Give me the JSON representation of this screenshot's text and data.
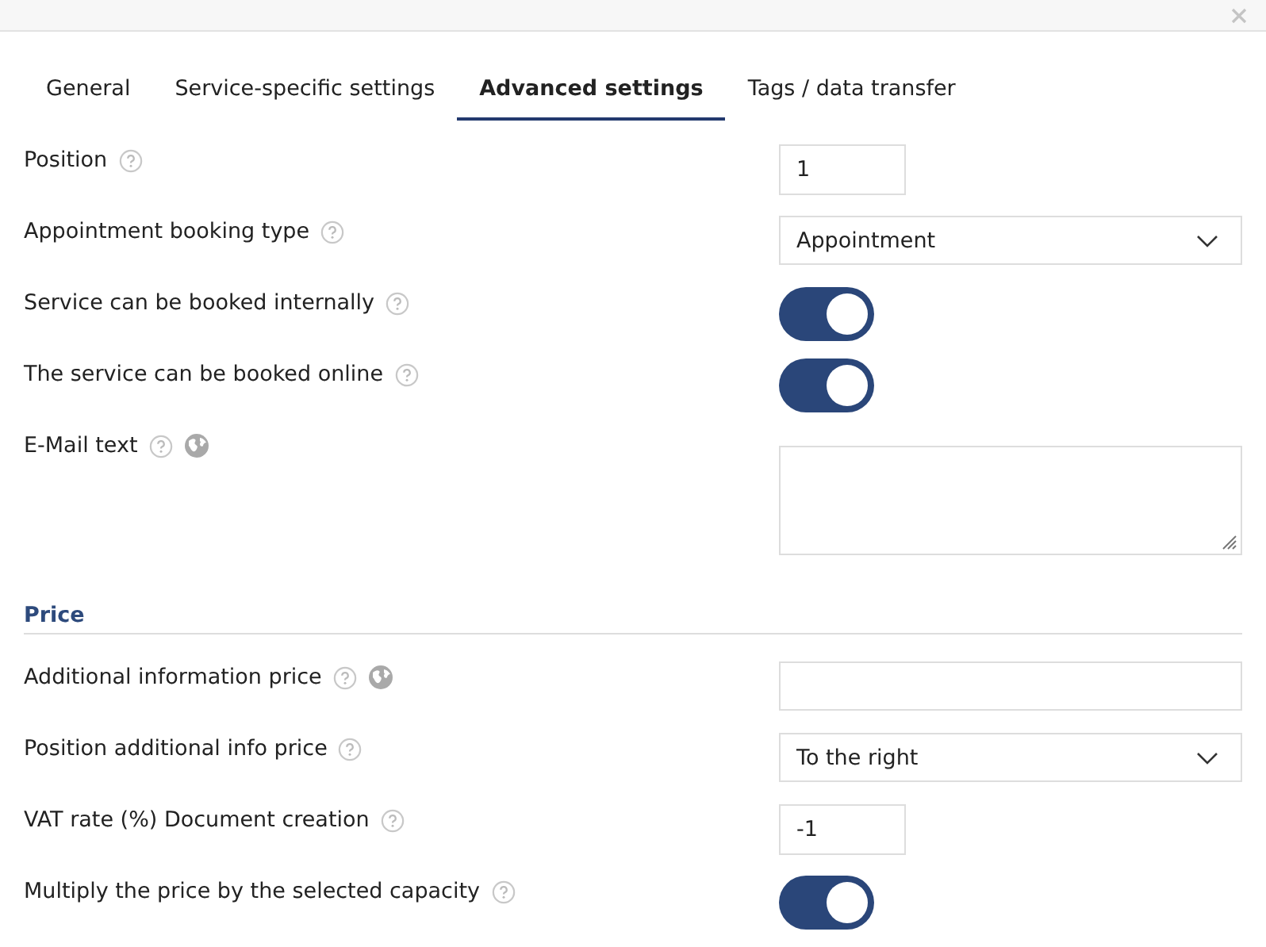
{
  "tabs": [
    {
      "label": "General",
      "selected": false
    },
    {
      "label": "Service-specific settings",
      "selected": false
    },
    {
      "label": "Advanced settings",
      "selected": true
    },
    {
      "label": "Tags / data transfer",
      "selected": false
    }
  ],
  "fields": [
    {
      "label": "Position",
      "help": true,
      "globe": false,
      "kind": "number",
      "value": "1"
    },
    {
      "label": "Appointment booking type",
      "help": true,
      "globe": false,
      "kind": "select",
      "value": "Appointment"
    },
    {
      "label": "Service can be booked internally",
      "help": true,
      "globe": false,
      "kind": "toggle",
      "on": true
    },
    {
      "label": "The service can be booked online",
      "help": true,
      "globe": false,
      "kind": "toggle",
      "on": true
    },
    {
      "label": "E-Mail text",
      "help": true,
      "globe": true,
      "kind": "textarea"
    }
  ],
  "price_section": {
    "title": "Price",
    "fields": [
      {
        "label": "Additional information price",
        "help": true,
        "globe": true,
        "kind": "text"
      },
      {
        "label": "Position additional info price",
        "help": true,
        "globe": false,
        "kind": "select",
        "value": "To the right"
      },
      {
        "label": "VAT rate (%) Document creation",
        "help": true,
        "globe": false,
        "kind": "number",
        "value": "-1"
      },
      {
        "label": "Multiply the price by the selected capacity",
        "help": true,
        "globe": false,
        "kind": "toggle",
        "on": true
      }
    ]
  }
}
